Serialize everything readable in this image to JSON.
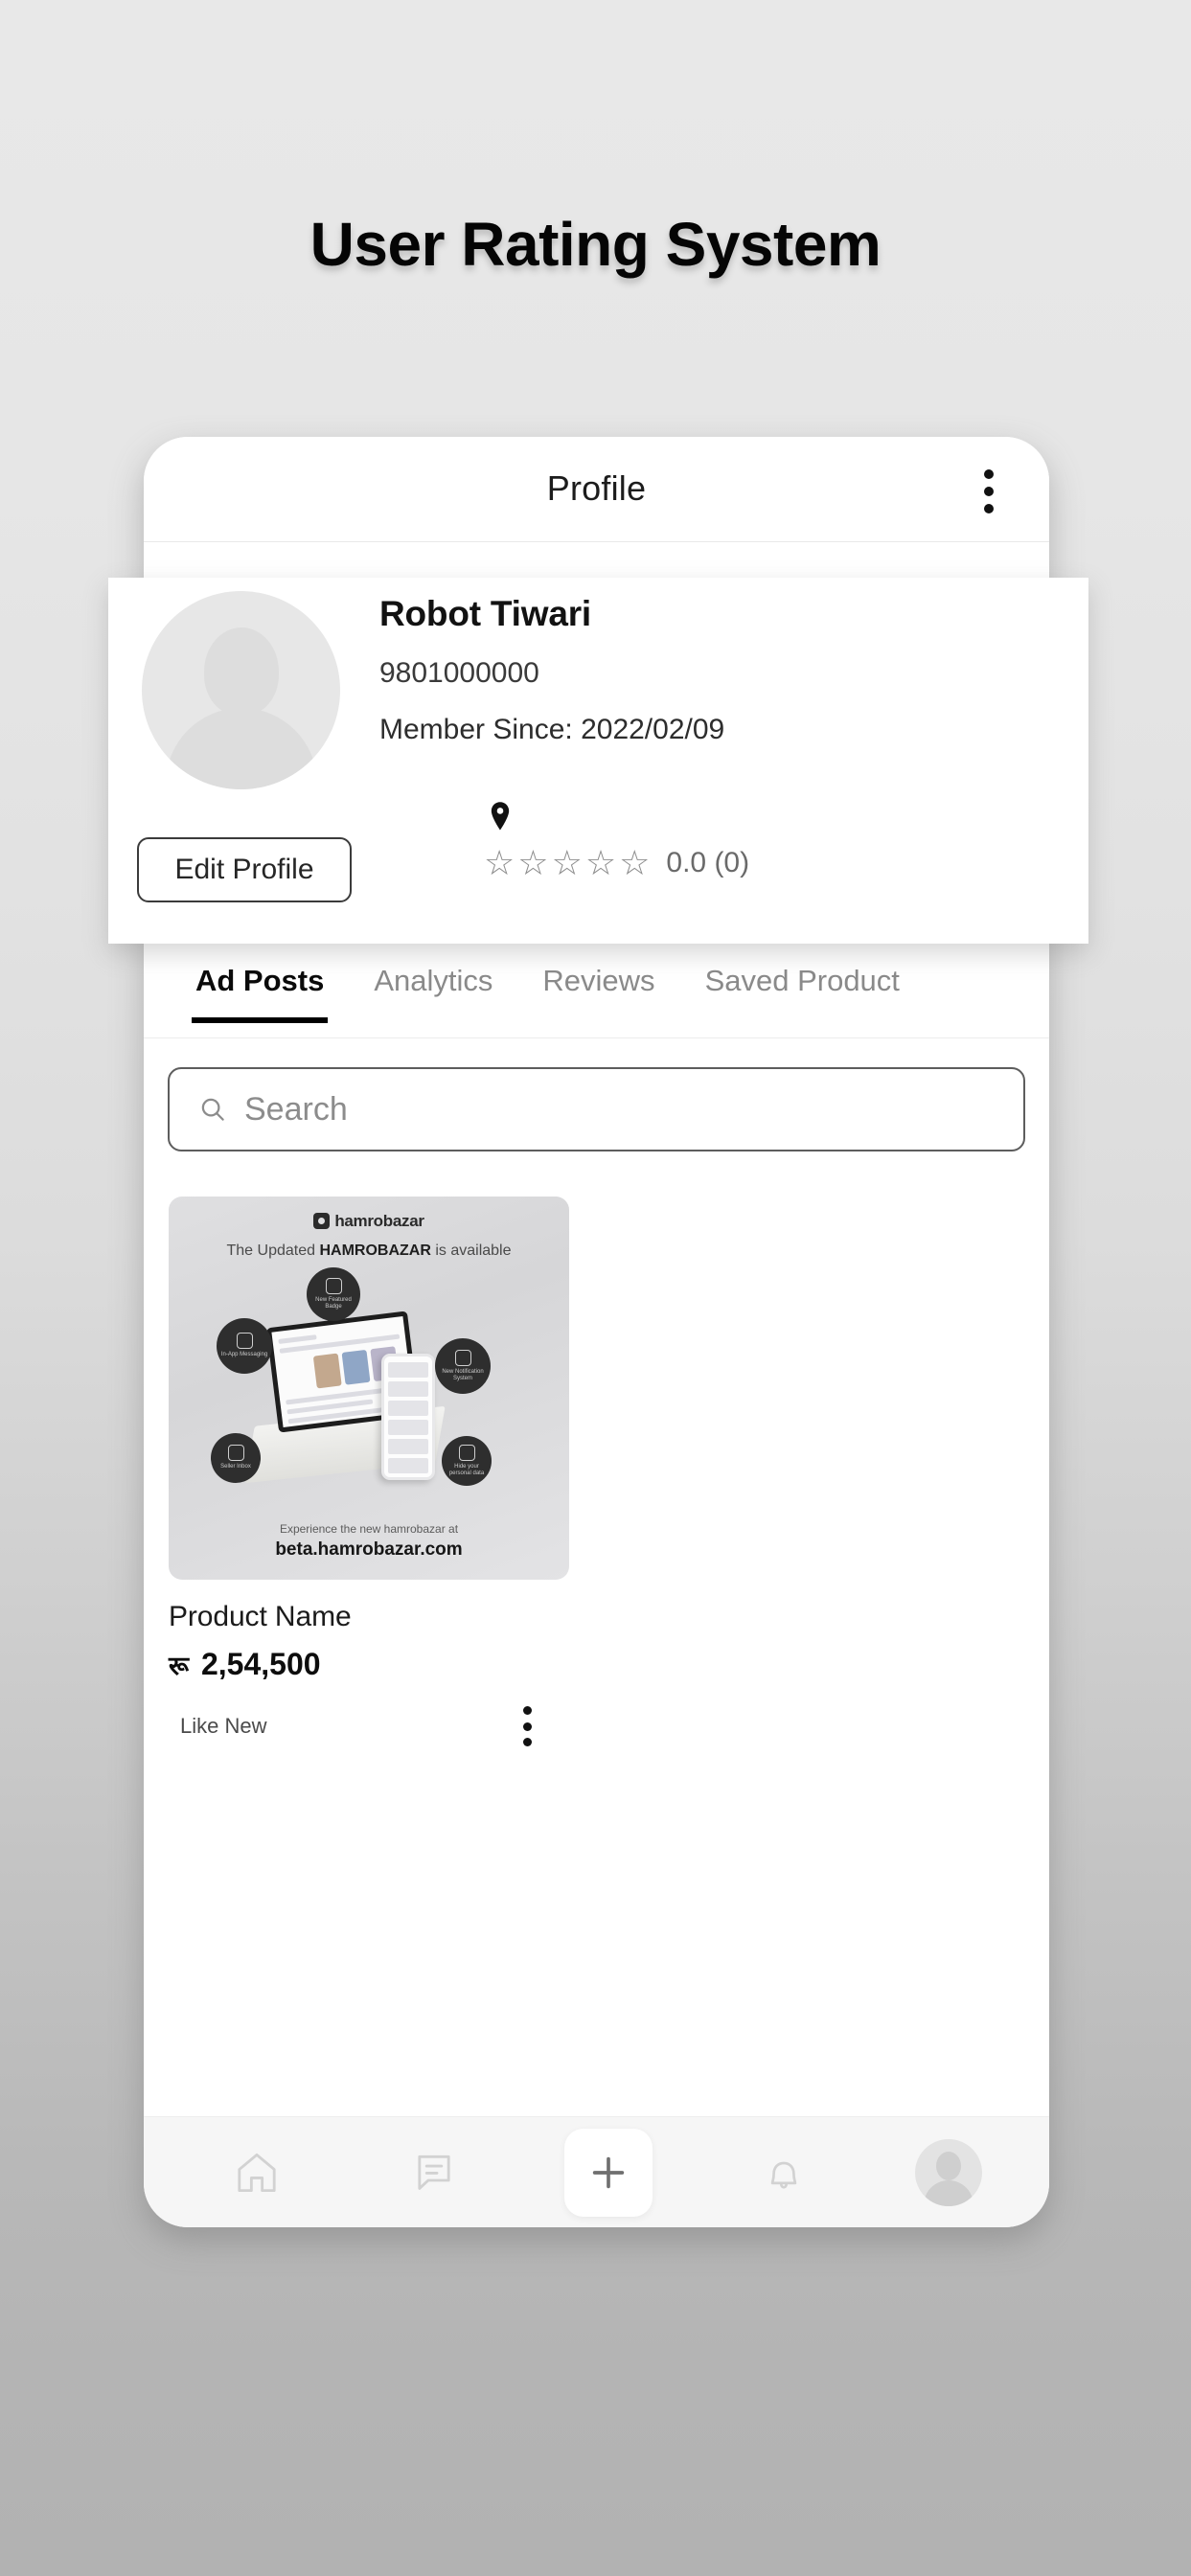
{
  "page": {
    "title": "User Rating System",
    "background_top": "#e8e8e8",
    "background_bottom": "#b2b2b2"
  },
  "appbar": {
    "title": "Profile",
    "menu_icon": "kebab-menu-icon"
  },
  "profile": {
    "avatar_icon": "avatar-placeholder-icon",
    "name": "Robot Tiwari",
    "phone": "9801000000",
    "member_since": "Member Since: 2022/02/09",
    "location_icon": "location-pin-icon",
    "edit_button": "Edit Profile",
    "stars": [
      "☆",
      "☆",
      "☆",
      "☆",
      "☆"
    ],
    "rating_text": "0.0 (0)"
  },
  "tabs": [
    {
      "label": "Ad Posts",
      "active": true
    },
    {
      "label": "Analytics",
      "active": false
    },
    {
      "label": "Reviews",
      "active": false
    },
    {
      "label": "Saved Product",
      "active": false
    }
  ],
  "search": {
    "placeholder": "Search",
    "value": "",
    "icon": "search-icon"
  },
  "product": {
    "name": "Product Name",
    "currency": "रू",
    "price": "2,54,500",
    "condition": "Like New",
    "menu_icon": "kebab-menu-icon",
    "image": {
      "logo_text": "hamrobazar",
      "headline_pre": "The Updated ",
      "headline_bold": "HAMROBAZAR",
      "headline_post": " is available",
      "footer_small": "Experience the new hamrobazar at",
      "footer_url": "beta.hamrobazar.com",
      "bubbles": [
        "New Featured Badge",
        "In-App Messaging",
        "New Notification System",
        "Seller Inbox",
        "Hide your personal data"
      ]
    }
  },
  "bottomnav": [
    {
      "name": "home-icon",
      "label": "Home"
    },
    {
      "name": "chat-icon",
      "label": "Messages"
    },
    {
      "name": "plus-icon",
      "label": "Post Ad"
    },
    {
      "name": "bell-icon",
      "label": "Notifications"
    },
    {
      "name": "profile-avatar-icon",
      "label": "Profile"
    }
  ]
}
